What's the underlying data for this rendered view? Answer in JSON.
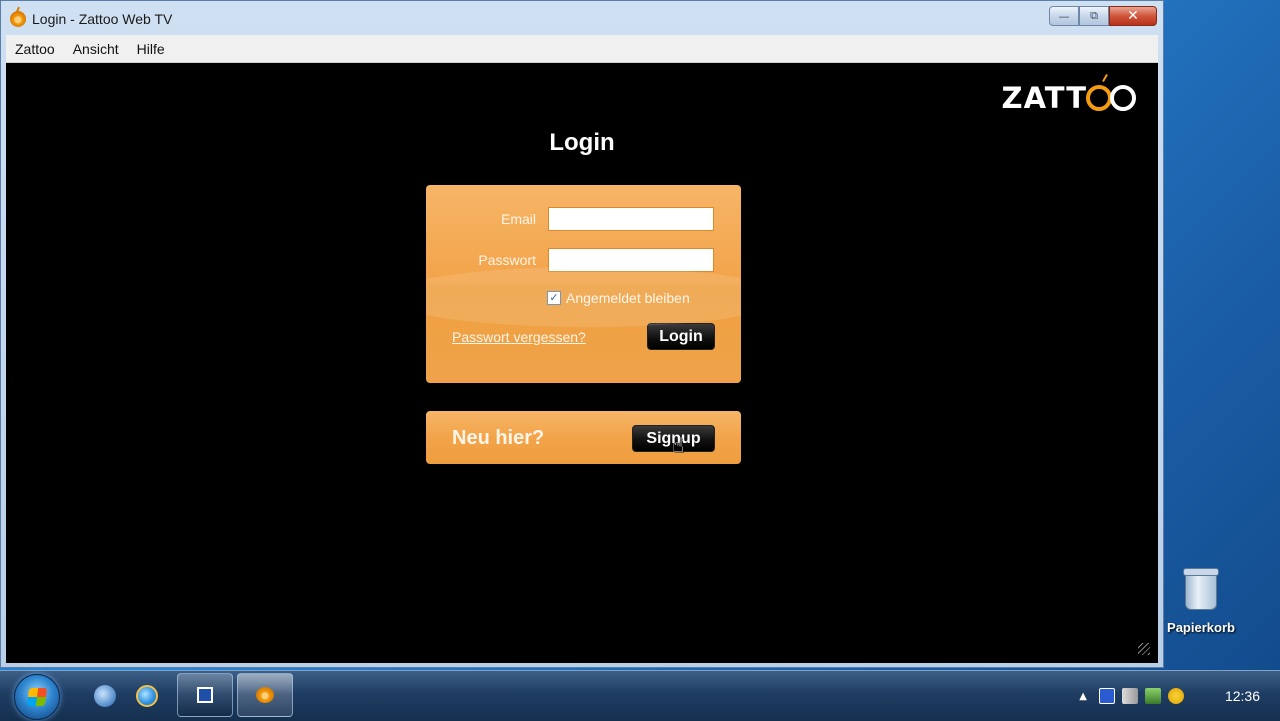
{
  "window": {
    "title": "Login - Zattoo Web TV",
    "controls": {
      "minimize": "—",
      "maximize": "⧉",
      "close": "✕"
    }
  },
  "menubar": {
    "items": [
      "Zattoo",
      "Ansicht",
      "Hilfe"
    ]
  },
  "brand": {
    "logo_text": "ZATT",
    "accent_color": "#f39c12"
  },
  "login": {
    "title": "Login",
    "email_label": "Email",
    "email_value": "",
    "password_label": "Passwort",
    "password_value": "",
    "remember_label": "Angemeldet bleiben",
    "remember_checked": true,
    "forgot_link": "Passwort vergessen?",
    "submit_label": "Login"
  },
  "signup": {
    "prompt": "Neu hier?",
    "button_label": "Signup"
  },
  "desktop": {
    "recycle_bin_label": "Papierkorb"
  },
  "taskbar": {
    "clock": "12:36"
  }
}
